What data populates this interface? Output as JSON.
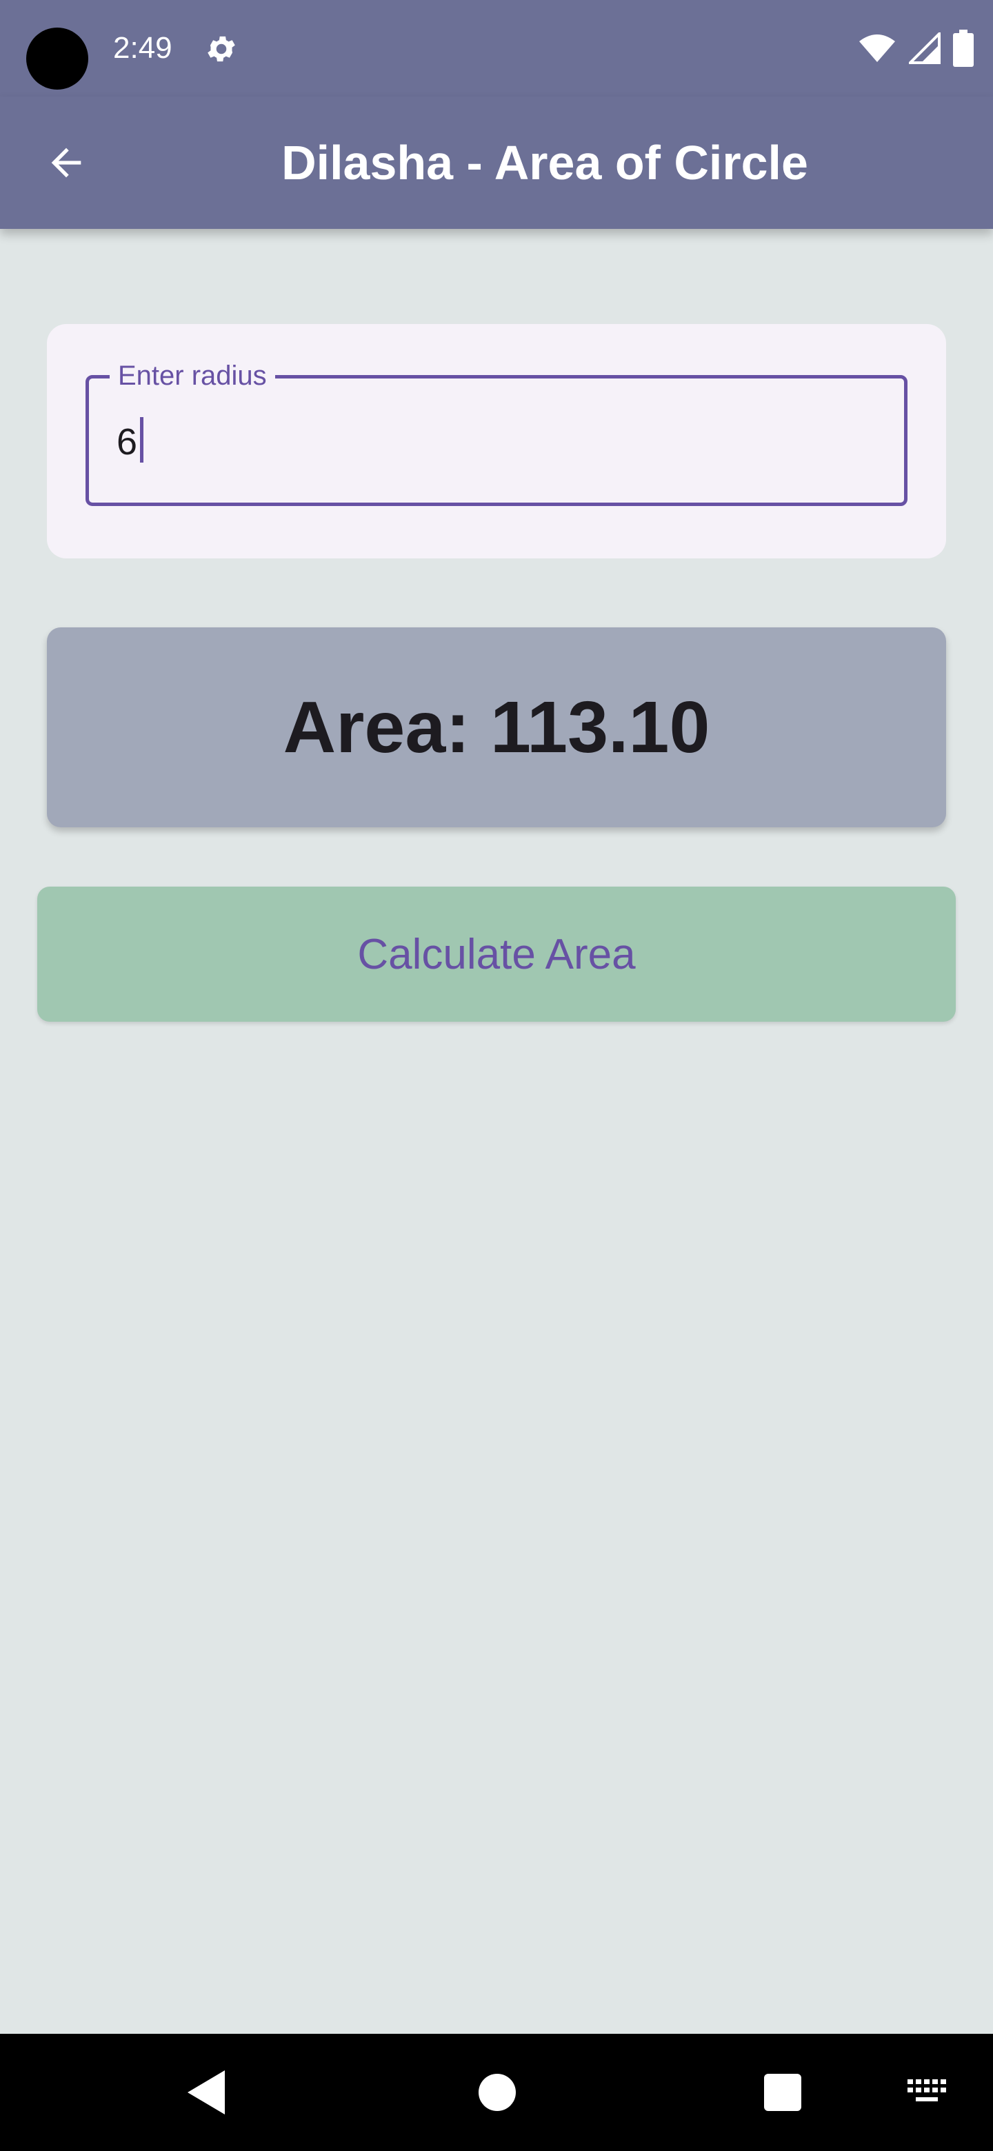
{
  "status_bar": {
    "time": "2:49",
    "icons": [
      "settings-icon",
      "wifi-icon",
      "cell-signal-icon",
      "battery-icon"
    ]
  },
  "app_bar": {
    "title": "Dilasha - Area of Circle",
    "back_icon": "arrow-left-icon"
  },
  "form": {
    "radius_label": "Enter radius",
    "radius_value": "6"
  },
  "result": {
    "text": "Area: 113.10"
  },
  "actions": {
    "calculate_label": "Calculate Area"
  },
  "nav_bar": {
    "icons": [
      "back-triangle-icon",
      "home-circle-icon",
      "recents-square-icon",
      "keyboard-icon"
    ]
  },
  "colors": {
    "app_bar": "#6c7096",
    "background": "#e0e6e6",
    "accent": "#6751a4",
    "result_card": "#a1a8b9",
    "button": "#a0c7b1"
  }
}
